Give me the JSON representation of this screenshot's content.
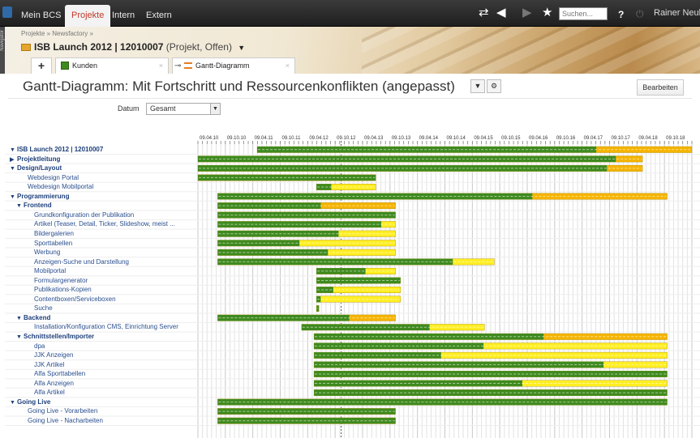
{
  "topnav": {
    "tabs": [
      "Mein BCS",
      "Projekte",
      "Intern",
      "Extern"
    ],
    "active": "Projekte",
    "search_placeholder": "Suchen...",
    "help": "?",
    "user": "Rainer Neuber"
  },
  "navigator_label": "Navigator",
  "header": {
    "breadcrumb": "Projekte  »  Newsfactory  »",
    "project_title": "ISB Launch 2012 | 12010007",
    "project_status": "(Projekt, Offen)",
    "tabs": [
      {
        "label": "Kunden",
        "icon": "table-icon"
      },
      {
        "label": "Gantt-Diagramm",
        "icon": "gantt-icon"
      }
    ]
  },
  "page": {
    "title": "Gantt-Diagramm: Mit Fortschritt und Ressourcenkonflikten (angepasst)",
    "edit_button": "Bearbeiten",
    "date_label": "Datum",
    "date_value": "Gesamt"
  },
  "gantt": {
    "date_labels": [
      "09.04.10",
      "09.10.10",
      "09.04.11",
      "09.10.11",
      "09.04.12",
      "09.10.12",
      "09.04.13",
      "09.10.13",
      "09.04.14",
      "09.10.14",
      "09.04.15",
      "09.10.15",
      "09.04.16",
      "09.10.16",
      "09.04.17",
      "09.10.17",
      "09.04.18",
      "09.10.18"
    ],
    "colors": {
      "done": "#3f8a1f",
      "remaining": "#f5b400",
      "conflict": "#ffee22"
    },
    "rows": [
      {
        "label": "ISB Launch 2012 | 12010007",
        "level": 0,
        "group": true,
        "expander": "▼",
        "start": 0.12,
        "end": 1.0,
        "progress": 0.78,
        "color": "orange"
      },
      {
        "label": "Projektleitung",
        "level": 0,
        "group": true,
        "expander": "▶",
        "start": 0.0,
        "end": 0.9,
        "progress": 0.94,
        "color": "orange"
      },
      {
        "label": "Design/Layout",
        "level": 0,
        "group": true,
        "expander": "▼",
        "start": 0.0,
        "end": 0.9,
        "progress": 0.92,
        "color": "orange"
      },
      {
        "label": "Webdesign Portal",
        "level": 1,
        "group": false,
        "expander": "",
        "start": 0.0,
        "end": 0.36,
        "progress": 1.0,
        "color": "green"
      },
      {
        "label": "Webdesign Mobilportal",
        "level": 1,
        "group": false,
        "expander": "",
        "start": 0.24,
        "end": 0.36,
        "progress": 0.25,
        "color": "yellow"
      },
      {
        "label": "Programmierung",
        "level": 0,
        "group": true,
        "expander": "▼",
        "start": 0.04,
        "end": 0.95,
        "progress": 0.7,
        "color": "orange"
      },
      {
        "label": "Frontend",
        "level": 1,
        "group": true,
        "expander": "▼",
        "start": 0.04,
        "end": 0.4,
        "progress": 0.58,
        "color": "orange"
      },
      {
        "label": "Grundkonfiguration der Publikation",
        "level": 2,
        "group": false,
        "expander": "",
        "start": 0.04,
        "end": 0.4,
        "progress": 1.0,
        "color": "yellow"
      },
      {
        "label": "Artikel (Teaser, Detail, Ticker, Slideshow, meist ...",
        "level": 2,
        "group": false,
        "expander": "",
        "start": 0.04,
        "end": 0.4,
        "progress": 0.92,
        "color": "yellow"
      },
      {
        "label": "Bildergalerien",
        "level": 2,
        "group": false,
        "expander": "",
        "start": 0.04,
        "end": 0.4,
        "progress": 0.68,
        "color": "yellow"
      },
      {
        "label": "Sporttabellen",
        "level": 2,
        "group": false,
        "expander": "",
        "start": 0.04,
        "end": 0.4,
        "progress": 0.46,
        "color": "yellow"
      },
      {
        "label": "Werbung",
        "level": 2,
        "group": false,
        "expander": "",
        "start": 0.04,
        "end": 0.4,
        "progress": 0.62,
        "color": "yellow"
      },
      {
        "label": "Anzeigen-Suche und Darstellung",
        "level": 2,
        "group": false,
        "expander": "",
        "start": 0.04,
        "end": 0.6,
        "progress": 0.85,
        "color": "yellow"
      },
      {
        "label": "Mobilportal",
        "level": 2,
        "group": false,
        "expander": "",
        "start": 0.24,
        "end": 0.4,
        "progress": 0.62,
        "color": "yellow"
      },
      {
        "label": "Formulargenerator",
        "level": 2,
        "group": false,
        "expander": "",
        "start": 0.24,
        "end": 0.41,
        "progress": 1.0,
        "color": "yellow"
      },
      {
        "label": "Publikations-Kopien",
        "level": 2,
        "group": false,
        "expander": "",
        "start": 0.24,
        "end": 0.41,
        "progress": 0.2,
        "color": "yellow"
      },
      {
        "label": "Contentboxen/Serviceboxen",
        "level": 2,
        "group": false,
        "expander": "",
        "start": 0.24,
        "end": 0.41,
        "progress": 0.05,
        "color": "yellow"
      },
      {
        "label": "Suche",
        "level": 2,
        "group": false,
        "expander": "",
        "start": 0.24,
        "end": 0.245,
        "progress": 1.0,
        "color": "green"
      },
      {
        "label": "Backend",
        "level": 1,
        "group": true,
        "expander": "▼",
        "start": 0.04,
        "end": 0.4,
        "progress": 0.74,
        "color": "orange"
      },
      {
        "label": "Installation/Konfiguration CMS, Einrichtung Server",
        "level": 2,
        "group": false,
        "expander": "",
        "start": 0.21,
        "end": 0.58,
        "progress": 0.7,
        "color": "yellow"
      },
      {
        "label": "Schnittstellen/Importer",
        "level": 1,
        "group": true,
        "expander": "▼",
        "start": 0.235,
        "end": 0.95,
        "progress": 0.65,
        "color": "orange"
      },
      {
        "label": "dpa",
        "level": 2,
        "group": false,
        "expander": "",
        "start": 0.235,
        "end": 0.95,
        "progress": 0.48,
        "color": "yellow"
      },
      {
        "label": "JJK Anzeigen",
        "level": 2,
        "group": false,
        "expander": "",
        "start": 0.235,
        "end": 0.95,
        "progress": 0.36,
        "color": "yellow"
      },
      {
        "label": "JJK Artikel",
        "level": 2,
        "group": false,
        "expander": "",
        "start": 0.235,
        "end": 0.95,
        "progress": 0.82,
        "color": "yellow"
      },
      {
        "label": "Alfa Sporttabellen",
        "level": 2,
        "group": false,
        "expander": "",
        "start": 0.235,
        "end": 0.95,
        "progress": 1.0,
        "color": "yellow"
      },
      {
        "label": "Alfa Anzeigen",
        "level": 2,
        "group": false,
        "expander": "",
        "start": 0.235,
        "end": 0.95,
        "progress": 0.59,
        "color": "yellow"
      },
      {
        "label": "Alfa Artikel",
        "level": 2,
        "group": false,
        "expander": "",
        "start": 0.235,
        "end": 0.95,
        "progress": 1.0,
        "color": "yellow"
      },
      {
        "label": "Going Live",
        "level": 0,
        "group": true,
        "expander": "▼",
        "start": 0.04,
        "end": 0.95,
        "progress": 1.0,
        "color": "orange"
      },
      {
        "label": "Going Live - Vorarbeiten",
        "level": 1,
        "group": false,
        "expander": "",
        "start": 0.04,
        "end": 0.4,
        "progress": 1.0,
        "color": "green"
      },
      {
        "label": "Going Live - Nacharbeiten",
        "level": 1,
        "group": false,
        "expander": "",
        "start": 0.04,
        "end": 0.4,
        "progress": 1.0,
        "color": "green"
      }
    ]
  }
}
